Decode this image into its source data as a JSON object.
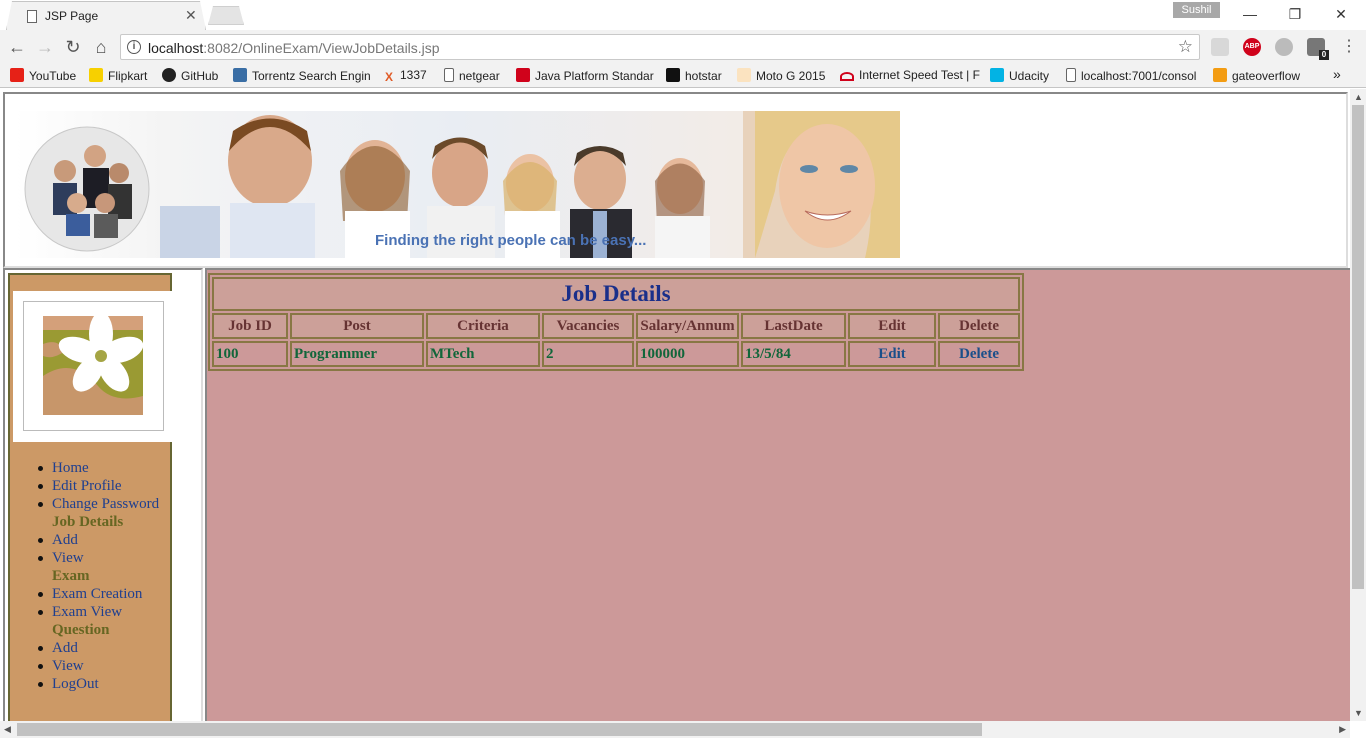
{
  "browser": {
    "tab_title": "JSP Page",
    "profile": "Sushil",
    "url_host": "localhost",
    "url_rest": ":8082/OnlineExam/ViewJobDetails.jsp",
    "extension_abp": "ABP",
    "extension_count": "0",
    "bookmarks": [
      {
        "label": "YouTube",
        "color": "#e62117"
      },
      {
        "label": "Flipkart",
        "color": "#f7d000"
      },
      {
        "label": "GitHub",
        "color": "#222222"
      },
      {
        "label": "Torrentz Search Engin",
        "color": "#3a6ea5"
      },
      {
        "label": "1337",
        "color": "#e05a26"
      },
      {
        "label": "netgear",
        "color": "#ffffff"
      },
      {
        "label": "Java Platform Standar",
        "color": "#d0021b"
      },
      {
        "label": "hotstar",
        "color": "#111111"
      },
      {
        "label": "Moto G 2015",
        "color": "#f5a623"
      },
      {
        "label": "Internet Speed Test | F",
        "color": "#d0021b"
      },
      {
        "label": "Udacity",
        "color": "#02b3e4"
      },
      {
        "label": "localhost:7001/consol",
        "color": "#ffffff"
      },
      {
        "label": "gateoverflow",
        "color": "#f39c12"
      }
    ],
    "more_bookmarks": "»"
  },
  "banner": {
    "tagline": "Finding the right people can be easy..."
  },
  "nav": {
    "items": [
      {
        "label": "Home",
        "kind": "link"
      },
      {
        "label": "Edit Profile",
        "kind": "link"
      },
      {
        "label": "Change Password",
        "kind": "link"
      },
      {
        "label": "Job Details",
        "kind": "section"
      },
      {
        "label": "Add",
        "kind": "link"
      },
      {
        "label": "View",
        "kind": "link"
      },
      {
        "label": "Exam",
        "kind": "section"
      },
      {
        "label": "Exam Creation",
        "kind": "link"
      },
      {
        "label": "Exam View",
        "kind": "link"
      },
      {
        "label": "Question",
        "kind": "section"
      },
      {
        "label": "Add",
        "kind": "link"
      },
      {
        "label": "View",
        "kind": "link"
      },
      {
        "label": "LogOut",
        "kind": "link"
      }
    ]
  },
  "job_table": {
    "title": "Job Details",
    "headers": [
      "Job ID",
      "Post",
      "Criteria",
      "Vacancies",
      "Salary/Annum",
      "LastDate",
      "Edit",
      "Delete"
    ],
    "rows": [
      {
        "job_id": "100",
        "post": "Programmer",
        "criteria": "MTech",
        "vacancies": "2",
        "salary": "100000",
        "last_date": "13/5/84",
        "edit": "Edit",
        "delete": "Delete"
      }
    ]
  },
  "colors": {
    "nav_panel": "#cc9966",
    "content_bg": "#cc9999",
    "heading_blue": "#1a2f8a",
    "cell_green": "#11663a"
  }
}
